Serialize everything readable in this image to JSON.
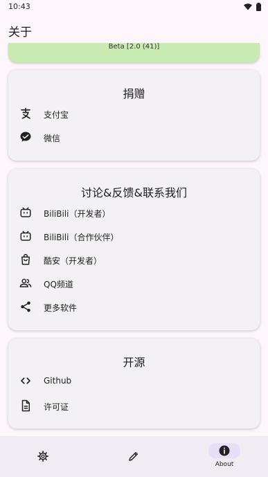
{
  "status_bar": {
    "time": "10:43"
  },
  "app_bar": {
    "title": "关于"
  },
  "version_card": {
    "text": "Beta [2.0 (41)]"
  },
  "donate": {
    "title": "捐赠",
    "items": [
      {
        "label": "支付宝",
        "icon": "alipay-icon"
      },
      {
        "label": "微信",
        "icon": "wechat-icon"
      }
    ]
  },
  "discuss": {
    "title": "讨论&反馈&联系我们",
    "items": [
      {
        "label": "BiliBili（开发者）",
        "icon": "bilibili-icon"
      },
      {
        "label": "BiliBili（合作伙伴）",
        "icon": "bilibili-icon"
      },
      {
        "label": "酷安（开发者）",
        "icon": "shopping-bag-icon"
      },
      {
        "label": "QQ频道",
        "icon": "people-icon"
      },
      {
        "label": "更多软件",
        "icon": "share-icon"
      }
    ]
  },
  "opensource": {
    "title": "开源",
    "items": [
      {
        "label": "Github",
        "icon": "code-icon"
      },
      {
        "label": "许可证",
        "icon": "document-icon"
      }
    ]
  },
  "bottom_nav": {
    "items": [
      {
        "label": "",
        "icon": "gear-icon"
      },
      {
        "label": "",
        "icon": "edit-icon"
      },
      {
        "label": "About",
        "icon": "info-icon",
        "selected": true
      }
    ]
  }
}
